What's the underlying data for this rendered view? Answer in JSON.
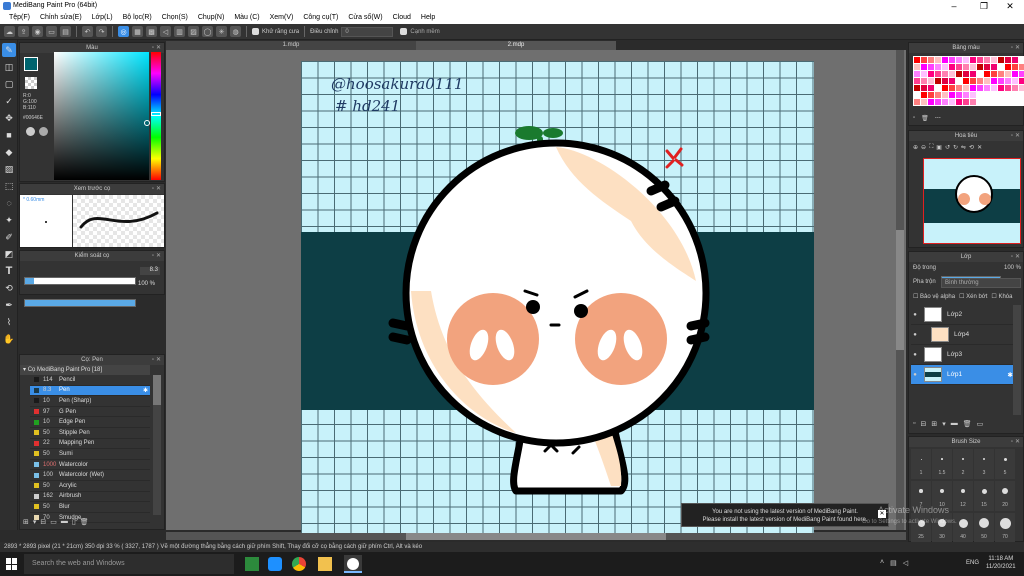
{
  "window": {
    "title": "MediBang Paint Pro (64bit)"
  },
  "menu": [
    "Tệp(F)",
    "Chỉnh sửa(E)",
    "Lớp(L)",
    "Bộ lọc(R)",
    "Chọn(S)",
    "Chụp(N)",
    "Màu (C)",
    "Xem(V)",
    "Công cụ(T)",
    "Cửa sổ(W)",
    "Cloud",
    "Help"
  ],
  "toolbar": {
    "antialias_label": "Khử răng cưa",
    "adjust_label": "Điều chỉnh",
    "adjust_value": "0",
    "smooth_label": "Cạnh mềm"
  },
  "doc_tabs": [
    "1.mdp",
    "2.mdp"
  ],
  "color_panel": {
    "title": "Màu",
    "rgb": [
      "R:0",
      "G:100",
      "B:110"
    ],
    "hex": "#00646E"
  },
  "brush_preview": {
    "title": "Xem trước cọ",
    "size": "0.60mm"
  },
  "brush_control": {
    "title": "Kiểm soát cọ",
    "size_value": "8.3",
    "opacity_value": "100 %",
    "size_fraction": 0.08,
    "opacity_fraction": 1.0
  },
  "brush_list": {
    "title": "Cọ: Pen",
    "group": "Cọ MediBang Paint Pro [18]",
    "items": [
      {
        "size": "114",
        "name": "Pencil",
        "color": "#1a1a1a"
      },
      {
        "size": "8.3",
        "name": "Pen",
        "color": "#1a3a4a"
      },
      {
        "size": "10",
        "name": "Pen (Sharp)",
        "color": "#1a1a1a"
      },
      {
        "size": "97",
        "name": "G Pen",
        "color": "#e03030"
      },
      {
        "size": "10",
        "name": "Edge Pen",
        "color": "#20a020"
      },
      {
        "size": "50",
        "name": "Stipple Pen",
        "color": "#e0c020"
      },
      {
        "size": "22",
        "name": "Mapping Pen",
        "color": "#e03030"
      },
      {
        "size": "50",
        "name": "Sumi",
        "color": "#e0c020"
      },
      {
        "size": "1000",
        "name": "Watercolor",
        "color": "#7ac0e8"
      },
      {
        "size": "100",
        "name": "Watercolor (Wet)",
        "color": "#7ac0e8"
      },
      {
        "size": "50",
        "name": "Acrylic",
        "color": "#e0c020"
      },
      {
        "size": "162",
        "name": "Airbrush",
        "color": "#cccccc"
      },
      {
        "size": "50",
        "name": "Blur",
        "color": "#e0c020"
      },
      {
        "size": "70",
        "name": "Smudge",
        "color": "#e8d8b0"
      }
    ]
  },
  "palette": {
    "title": "Bảng màu",
    "menu": "---"
  },
  "navigator": {
    "title": "Hoa tiêu"
  },
  "layers": {
    "title": "Lớp",
    "opacity_label": "Độ trong",
    "opacity_value": "100 %",
    "opacity_fraction": 1.0,
    "blend_label": "Pha trộn",
    "blend_value": "Bình thường",
    "protect_alpha": "Bảo vệ alpha",
    "clipping": "Xén bớt",
    "lock": "Khóa",
    "items": [
      {
        "name": "Lớp2",
        "selected": false
      },
      {
        "name": "Lớp4",
        "selected": false
      },
      {
        "name": "Lớp3",
        "selected": false
      },
      {
        "name": "Lớp1",
        "selected": true
      }
    ]
  },
  "brush_size_panel": {
    "title": "Brush Size",
    "sizes": [
      "1",
      "1.5",
      "2",
      "3",
      "5",
      "7",
      "10",
      "12",
      "15",
      "20",
      "25",
      "30",
      "40",
      "50",
      "70"
    ]
  },
  "canvas": {
    "signature_line1": "@hoosakura0111",
    "signature_line2": "# hd241",
    "band_color": "#0d3e45",
    "grid_color": "#c8f2fa",
    "character_fill": "#ffffff",
    "blush_color": "#f2a37e",
    "skin_color": "#fde0c2",
    "sprout_color": "#1a7a2e",
    "anger_mark_color": "#e02020"
  },
  "notification": {
    "line1": "You are not using the latest version of MediBang Paint.",
    "line2": "Please install the latest version of MediBang Paint found here.",
    "watermark": "Activate Windows",
    "watermark_sub": "Go to Settings to activate Windows."
  },
  "statusbar": {
    "text": "2893 * 2893 pixel   (21 * 21cm)  350 dpi   33 %  ( 3327, 1787 )  Vẽ một đường thẳng bằng cách giữ phím Shift, Thay đổi cỡ cọ bằng cách giữ phím Ctrl, Alt và kéo"
  },
  "taskbar": {
    "search_placeholder": "Search the web and Windows",
    "lang": "ENG",
    "time": "11:18 AM",
    "date": "11/20/2021"
  }
}
